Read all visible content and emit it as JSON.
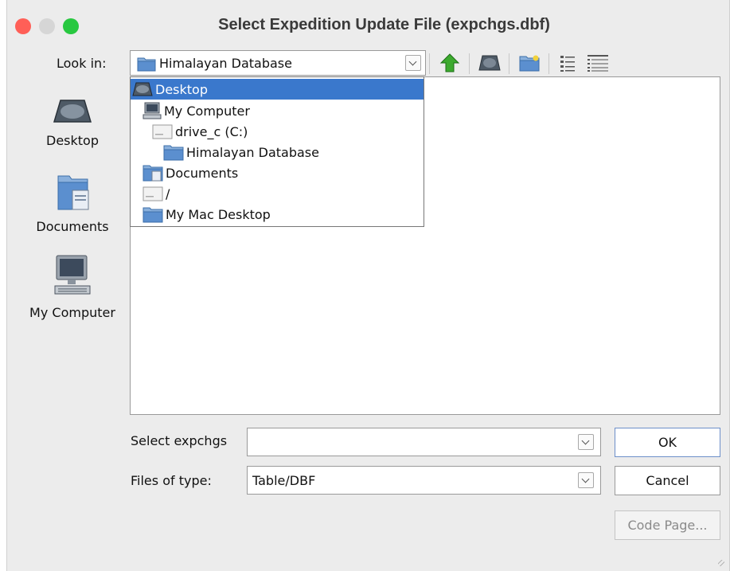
{
  "window": {
    "title": "Select Expedition Update File (expchgs.dbf)"
  },
  "lookin": {
    "label": "Look in:",
    "value": "Himalayan Database"
  },
  "toolbar": {
    "icons": [
      "up-folder-icon",
      "desktop-icon",
      "new-folder-icon",
      "list-view-icon",
      "details-view-icon"
    ]
  },
  "places": [
    {
      "label": "Desktop",
      "icon": "desktop-icon"
    },
    {
      "label": "Documents",
      "icon": "documents-icon"
    },
    {
      "label": "My Computer",
      "icon": "computer-icon"
    }
  ],
  "dropdown": {
    "items": [
      {
        "label": "Desktop",
        "icon": "desktop-icon",
        "selected": true
      },
      {
        "label": "My Computer",
        "icon": "computer-icon"
      },
      {
        "label": "drive_c (C:)",
        "icon": "drive-icon"
      },
      {
        "label": "Himalayan Database",
        "icon": "folder-icon"
      },
      {
        "label": "Documents",
        "icon": "documents-icon"
      },
      {
        "label": "/",
        "icon": "drive-icon"
      },
      {
        "label": "My Mac Desktop",
        "icon": "folder-icon"
      }
    ]
  },
  "form": {
    "select_label": "Select expchgs",
    "select_value": "",
    "type_label": "Files of type:",
    "type_value": "Table/DBF"
  },
  "buttons": {
    "ok": "OK",
    "cancel": "Cancel",
    "code_page": "Code Page..."
  },
  "colors": {
    "selection": "#3a78cc",
    "folder": "#5b8fcf",
    "up_arrow": "#3caa2e"
  }
}
